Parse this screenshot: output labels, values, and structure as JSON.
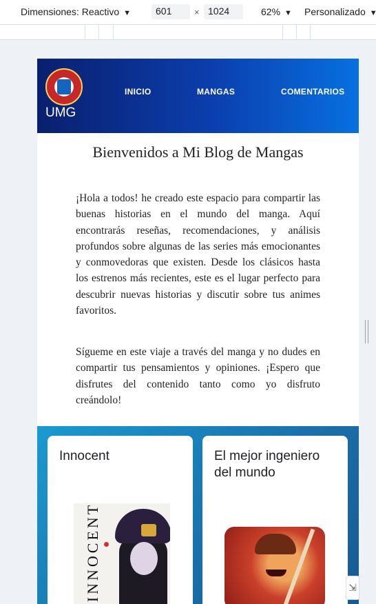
{
  "devtools": {
    "dimensions_label": "Dimensiones: Reactivo",
    "width_value": "601",
    "times": "×",
    "height_value": "1024",
    "zoom": "62%",
    "preset": "Personalizado",
    "caret": "▼"
  },
  "site": {
    "brand": "UMG",
    "nav": [
      "INICIO",
      "MANGAS",
      "COMENTARIOS"
    ],
    "title": "Bienvenidos a Mi Blog de Mangas",
    "paragraphs": [
      "¡Hola a todos! he creado este espacio para compartir las buenas historias en el mundo del manga. Aquí encontrarás reseñas, recomendaciones, y análisis profundos sobre algunas de las series más emocionantes y conmovedoras que existen. Desde los clásicos hasta los estrenos más recientes, este es el lugar perfecto para descubrir nuevas historias y discutir sobre tus animes favoritos.",
      "Sígueme en este viaje a través del manga y no dudes en compartir tus pensamientos y opiniones. ¡Espero que disfrutes del contenido tanto como yo disfruto creándolo!"
    ],
    "cards": [
      {
        "title": "Innocent",
        "cover_text": "INNOCENT"
      },
      {
        "title": "El mejor ingeniero del mundo"
      }
    ]
  },
  "colors": {
    "header_start": "#0a1f6e",
    "header_end": "#0870e0",
    "cards_bg": "#1b9ad0"
  }
}
